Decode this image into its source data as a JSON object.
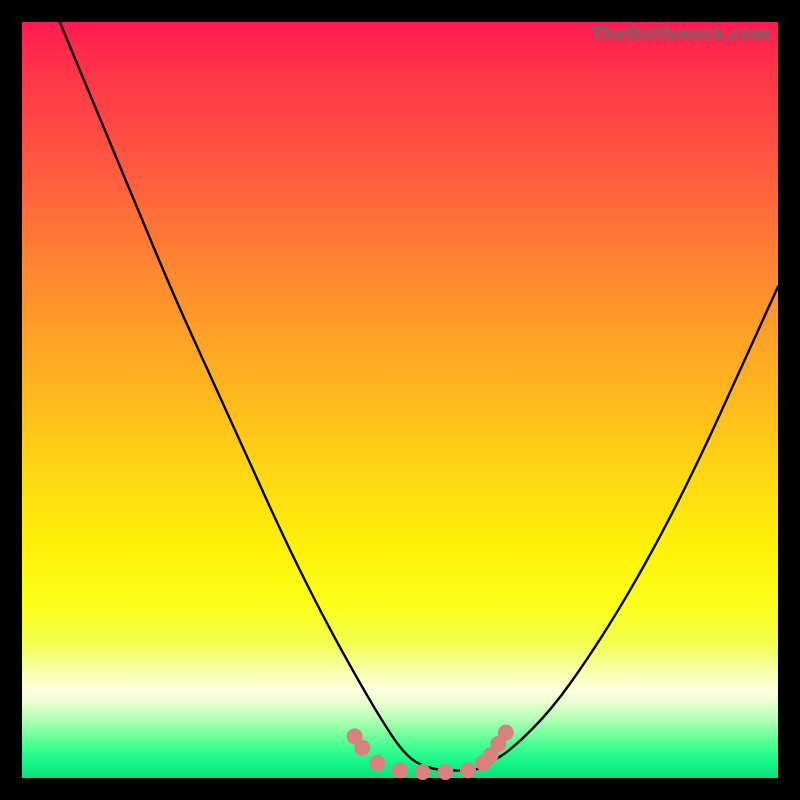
{
  "attribution": "TheBottleneck.com",
  "chart_data": {
    "type": "line",
    "title": "",
    "xlabel": "",
    "ylabel": "",
    "xlim": [
      0,
      100
    ],
    "ylim": [
      0,
      100
    ],
    "series": [
      {
        "name": "bottleneck-curve",
        "x": [
          5,
          10,
          15,
          20,
          25,
          30,
          35,
          40,
          45,
          48,
          50,
          52,
          55,
          58,
          60,
          62,
          65,
          70,
          75,
          80,
          85,
          90,
          95,
          100
        ],
        "values": [
          100,
          88,
          76,
          64,
          53,
          42,
          31,
          21,
          12,
          7,
          4,
          2,
          1,
          1,
          1,
          2,
          4,
          9,
          16,
          24,
          33,
          43,
          54,
          65
        ]
      }
    ],
    "markers": {
      "name": "highlight-points",
      "color": "#d9827d",
      "x": [
        44,
        45,
        47,
        50,
        53,
        56,
        59,
        61,
        62,
        63,
        64
      ],
      "values": [
        5.5,
        4.0,
        2.0,
        1.0,
        0.8,
        0.8,
        1.0,
        2.0,
        3.0,
        4.5,
        6.0
      ]
    },
    "gradient_stops": [
      {
        "pct": 0,
        "color": "#ff1a52"
      },
      {
        "pct": 20,
        "color": "#ff5c3f"
      },
      {
        "pct": 48,
        "color": "#ffb41f"
      },
      {
        "pct": 70,
        "color": "#fff30a"
      },
      {
        "pct": 90,
        "color": "#e8ffd0"
      },
      {
        "pct": 100,
        "color": "#0EDC7C"
      }
    ]
  }
}
